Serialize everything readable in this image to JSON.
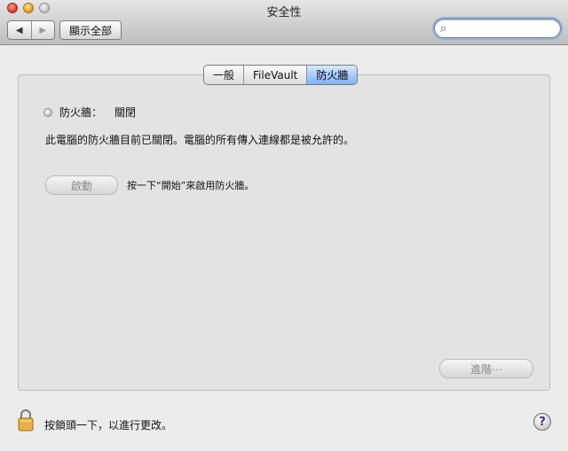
{
  "window": {
    "title": "安全性"
  },
  "toolbar": {
    "back_symbol": "◀",
    "forward_symbol": "▶",
    "show_all_label": "顯示全部",
    "search": {
      "value": "",
      "placeholder": ""
    }
  },
  "tabs": [
    {
      "label": "一般",
      "active": false
    },
    {
      "label": "FileVault",
      "active": false
    },
    {
      "label": "防火牆",
      "active": true
    }
  ],
  "firewall": {
    "status_label": "防火牆：",
    "status_value": "關閉",
    "description": "此電腦的防火牆目前已關閉。電腦的所有傳入連線都是被允許的。",
    "start_button_label": "啟動",
    "start_hint": "按一下“開始”來啟用防火牆。",
    "advanced_button_label": "進階⋯"
  },
  "footer": {
    "lock_message": "按鎖頭一下，以進行更改。",
    "help_symbol": "?"
  },
  "icons": {
    "search_icon_glyph": "⌕"
  },
  "colors": {
    "accent_tab": "#7fb1ff",
    "lock_body": "#e7b24a",
    "help_question": "#4b2b7a"
  }
}
